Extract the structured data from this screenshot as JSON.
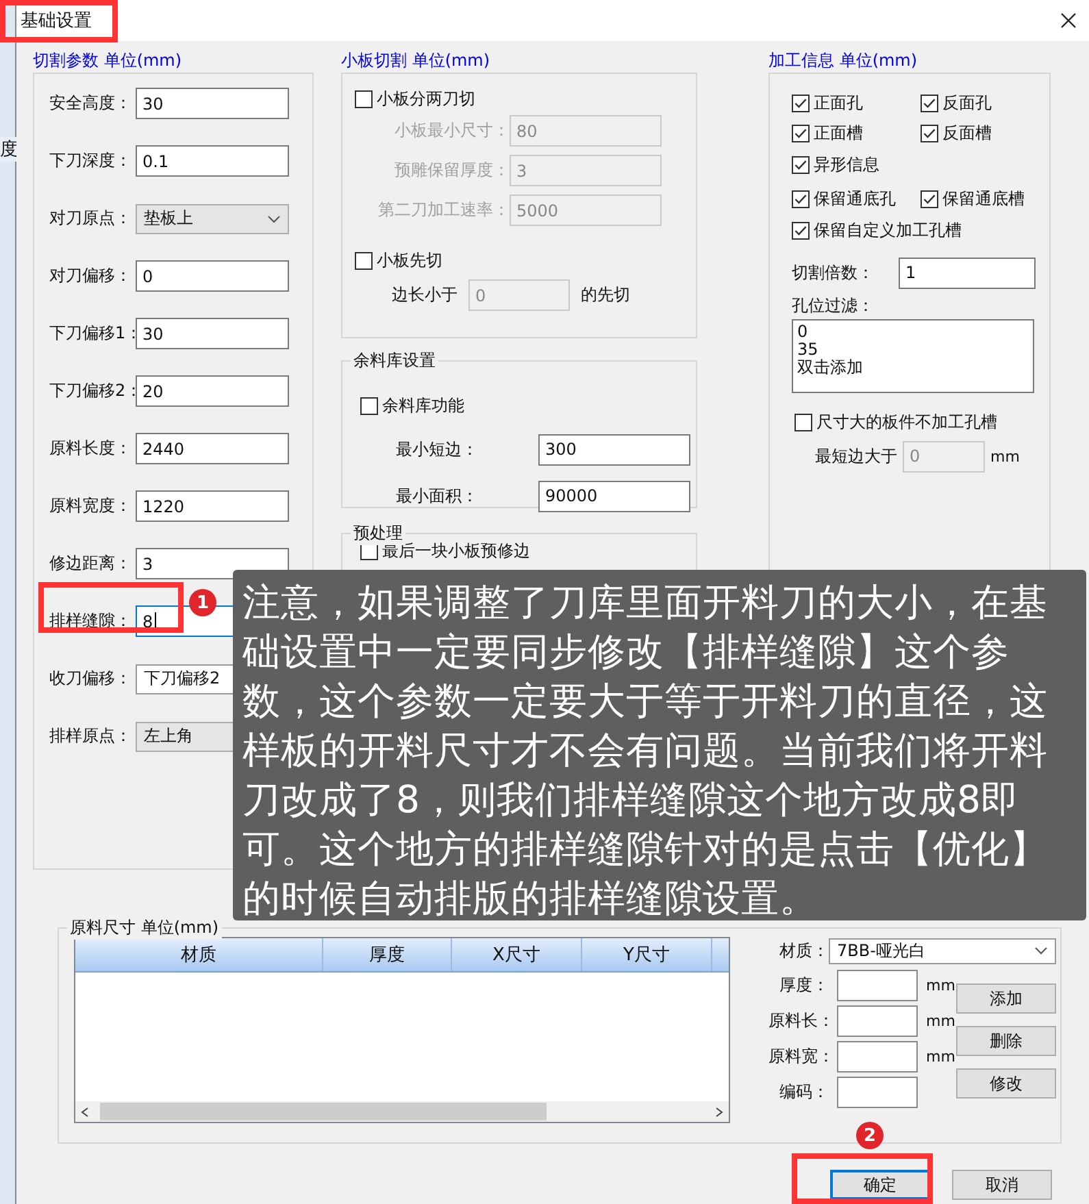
{
  "window": {
    "title": "基础设置"
  },
  "background_window": {
    "tab_text": "度"
  },
  "cutting_params": {
    "title": "切割参数 单位(mm)",
    "fields": [
      {
        "label": "安全高度：",
        "kind": "text",
        "value": "30",
        "focused": false
      },
      {
        "label": "下刀深度：",
        "kind": "text",
        "value": "0.1",
        "focused": false
      },
      {
        "label": "对刀原点：",
        "kind": "select",
        "value": "垫板上",
        "focused": false
      },
      {
        "label": "对刀偏移：",
        "kind": "text",
        "value": "0",
        "focused": false
      },
      {
        "label": "下刀偏移1：",
        "kind": "text",
        "value": "30",
        "focused": false
      },
      {
        "label": "下刀偏移2：",
        "kind": "text",
        "value": "20",
        "focused": false
      },
      {
        "label": "原料长度：",
        "kind": "text",
        "value": "2440",
        "focused": false
      },
      {
        "label": "原料宽度：",
        "kind": "text",
        "value": "1220",
        "focused": false
      },
      {
        "label": "修边距离：",
        "kind": "text",
        "value": "3",
        "focused": false
      },
      {
        "label": "排样缝隙：",
        "kind": "text",
        "value": "8",
        "focused": true
      },
      {
        "label": "收刀偏移：",
        "kind": "editable-select",
        "value": "下刀偏移2",
        "focused": false
      },
      {
        "label": "排样原点：",
        "kind": "select",
        "value": "左上角",
        "focused": false
      }
    ]
  },
  "small_board": {
    "title": "小板切割 单位(mm)",
    "two_cut": {
      "label": "小板分两刀切",
      "checked": false
    },
    "two_cut_fields": [
      {
        "label": "小板最小尺寸：",
        "value": "80",
        "disabled": true
      },
      {
        "label": "预雕保留厚度：",
        "value": "3",
        "disabled": true
      },
      {
        "label": "第二刀加工速率：",
        "value": "5000",
        "disabled": true
      }
    ],
    "cut_first": {
      "label": "小板先切",
      "checked": false
    },
    "cut_first_row": {
      "prefix": "边长小于",
      "value": "0",
      "suffix": "的先切",
      "disabled": true
    }
  },
  "remnant": {
    "title": "余料库设置",
    "enable": {
      "label": "余料库功能",
      "checked": false
    },
    "fields": [
      {
        "label": "最小短边：",
        "value": "300"
      },
      {
        "label": "最小面积：",
        "value": "90000"
      }
    ]
  },
  "preprocess": {
    "title": "预处理",
    "options": [
      {
        "label": "最后一块小板预修边",
        "checked": false
      }
    ]
  },
  "processing_info": {
    "title": "加工信息 单位(mm)",
    "option_rows": [
      [
        {
          "label": "正面孔",
          "checked": true
        },
        {
          "label": "反面孔",
          "checked": true
        }
      ],
      [
        {
          "label": "正面槽",
          "checked": true
        },
        {
          "label": "反面槽",
          "checked": true
        }
      ],
      [
        {
          "label": "异形信息",
          "checked": true
        }
      ],
      [
        {
          "label": "保留通底孔",
          "checked": true
        },
        {
          "label": "保留通底槽",
          "checked": true
        }
      ],
      [
        {
          "label": "保留自定义加工孔槽",
          "checked": true
        }
      ]
    ],
    "multiplier": {
      "label": "切割倍数：",
      "value": "1"
    },
    "hole_filter": {
      "label": "孔位过滤：",
      "lines": [
        "0",
        "35",
        "双击添加"
      ]
    },
    "skip_large": {
      "label": "尺寸大的板件不加工孔槽",
      "checked": false
    },
    "min_edge": {
      "label": "最短边大于",
      "value": "0",
      "unit": "mm",
      "disabled": true
    }
  },
  "material_size": {
    "title": "原料尺寸 单位(mm)",
    "table": {
      "columns": [
        "材质",
        "厚度",
        "X尺寸",
        "Y尺寸"
      ]
    },
    "material": {
      "label": "材质：",
      "value": "7BB-哑光白"
    },
    "fields": [
      {
        "label": "厚度：",
        "unit": "mm"
      },
      {
        "label": "原料长：",
        "unit": "mm"
      },
      {
        "label": "原料宽：",
        "unit": "mm"
      },
      {
        "label": "编码："
      }
    ],
    "buttons": [
      "添加",
      "删除",
      "修改"
    ]
  },
  "footer_buttons": [
    {
      "label": "确定",
      "default": true
    },
    {
      "label": "取消",
      "default": false
    }
  ],
  "annotations": {
    "callout": "注意，如果调整了刀库里面开料刀的大小，在基础设置中一定要同步修改【排样缝隙】这个参数，这个参数一定要大于等于开料刀的直径，这样板的开料尺寸才不会有问题。当前我们将开料刀改成了8，则我们排样缝隙这个地方改成8即可。这个地方的排样缝隙针对的是点击【优化】的时候自动排版的排样缝隙设置。",
    "badges": [
      "1",
      "2"
    ]
  }
}
